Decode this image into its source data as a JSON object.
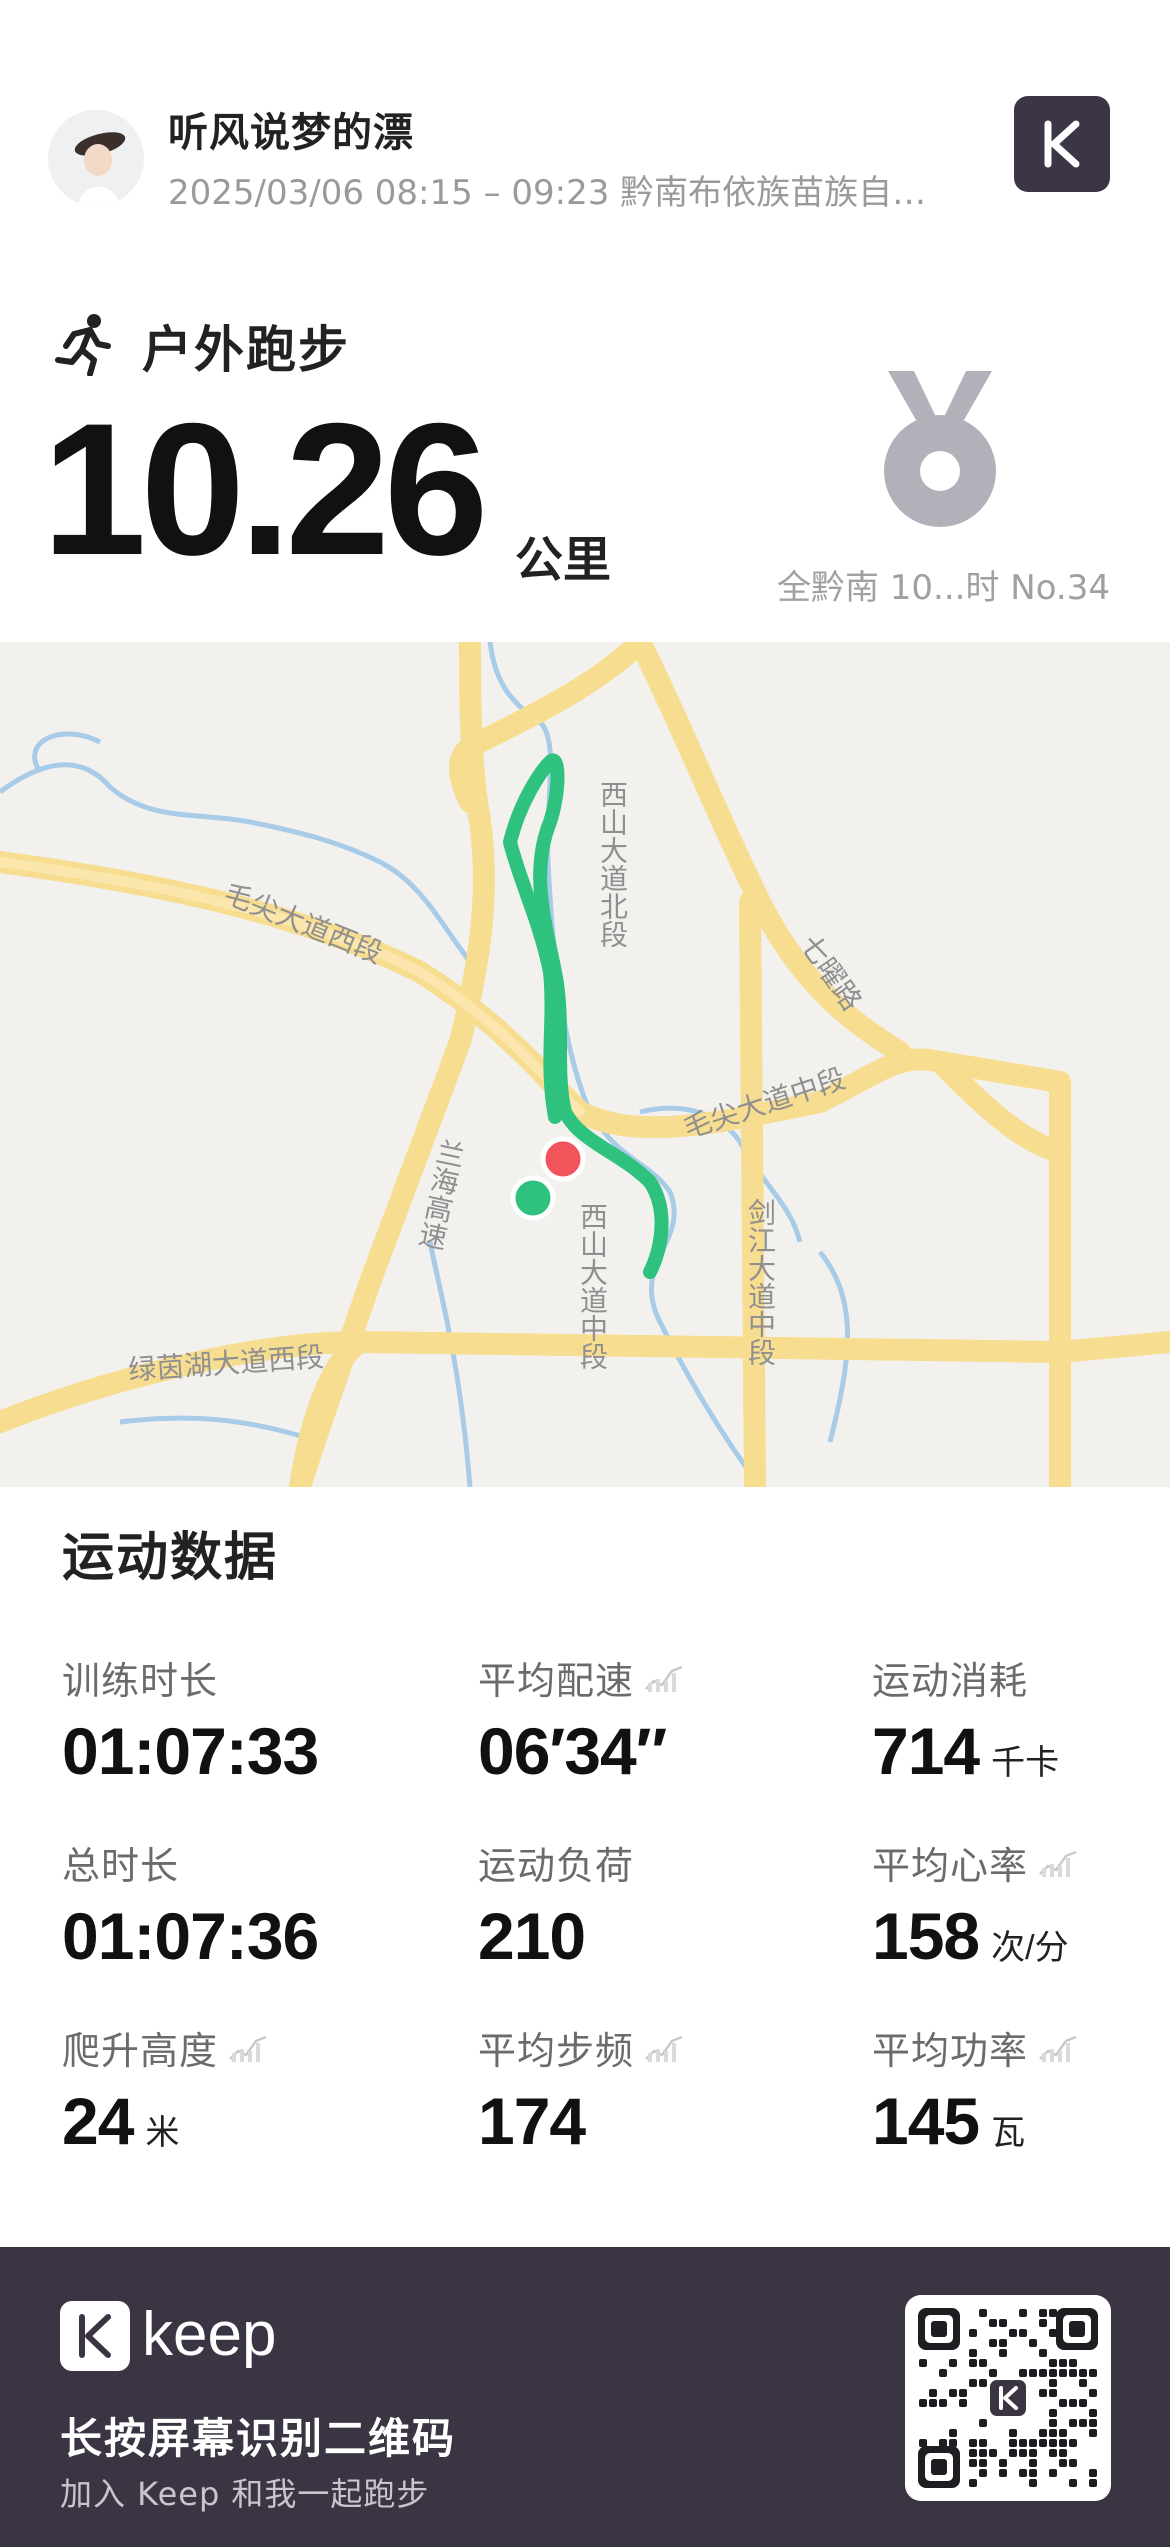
{
  "header": {
    "username": "听风说梦的漂",
    "subline": "2025/03/06 08:15 – 09:23 黔南布依族苗族自…",
    "avatar_icon": "user-avatar",
    "brand_icon": "keep-k-icon"
  },
  "activity": {
    "icon": "running-person-icon",
    "title": "户外跑步",
    "distance": "10.26",
    "unit": "公里",
    "medal_icon": "medal-icon",
    "rank": "全黔南 10...时 No.34"
  },
  "map": {
    "labels": [
      "西山大道北段",
      "毛尖大道西段",
      "七曜路",
      "毛尖大道中段",
      "兰海高速",
      "西山大道中段",
      "剑江大道中段",
      "绿茵湖大道西段"
    ],
    "colors": {
      "route": "#2ec27e",
      "start": "#2ec27e",
      "end": "#f2545b",
      "road": "#f7dd8f",
      "water": "#a8cbe8",
      "land": "#f3f1ee"
    }
  },
  "stats": {
    "title": "运动数据",
    "items": [
      {
        "label": "训练时长",
        "value": "01:07:33",
        "unit": "",
        "chart_icon": false
      },
      {
        "label": "平均配速",
        "value": "06′34″",
        "unit": "",
        "chart_icon": true
      },
      {
        "label": "运动消耗",
        "value": "714",
        "unit": "千卡",
        "chart_icon": false
      },
      {
        "label": "总时长",
        "value": "01:07:36",
        "unit": "",
        "chart_icon": false
      },
      {
        "label": "运动负荷",
        "value": "210",
        "unit": "",
        "chart_icon": false
      },
      {
        "label": "平均心率",
        "value": "158",
        "unit": "次/分",
        "chart_icon": true
      },
      {
        "label": "爬升高度",
        "value": "24",
        "unit": "米",
        "chart_icon": true
      },
      {
        "label": "平均步频",
        "value": "174",
        "unit": "",
        "chart_icon": true
      },
      {
        "label": "平均功率",
        "value": "145",
        "unit": "瓦",
        "chart_icon": true
      }
    ]
  },
  "footer": {
    "logo_text": "keep",
    "line1": "长按屏幕识别二维码",
    "line2": "加入 Keep 和我一起跑步",
    "qr_icon": "qr-code-icon"
  }
}
